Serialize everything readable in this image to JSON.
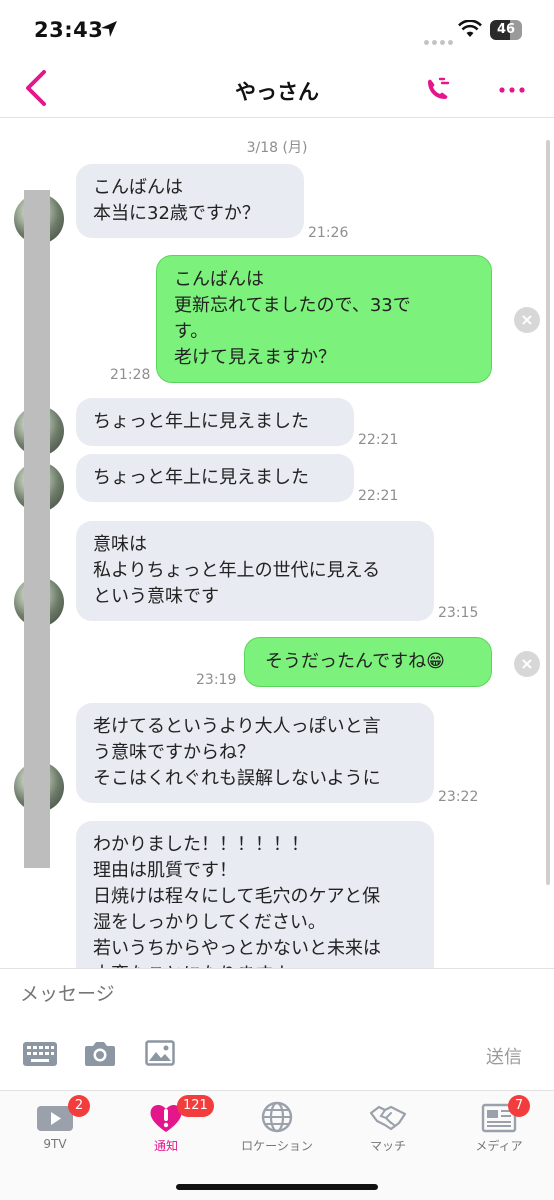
{
  "status": {
    "time": "23:43",
    "battery": "46"
  },
  "header": {
    "title": "やっさん"
  },
  "chat": {
    "date": "3/18 (月)",
    "messages": [
      {
        "side": "in",
        "text": "こんばんは\n本当に32歳ですか？",
        "time": "21:26"
      },
      {
        "side": "out",
        "text": "こんばんは\n更新忘れてましたので、33で\nす。\n老けて見えますか？",
        "time": "21:28"
      },
      {
        "side": "in",
        "text": "ちょっと年上に見えました",
        "time": "22:21"
      },
      {
        "side": "in",
        "text": "ちょっと年上に見えました",
        "time": "22:21"
      },
      {
        "side": "in",
        "text": "意味は\n私よりちょっと年上の世代に見える\nという意味です",
        "time": "23:15"
      },
      {
        "side": "out",
        "text": "そうだったんですね😁",
        "time": "23:19"
      },
      {
        "side": "in",
        "text": "老けてるというより大人っぽいと言\nう意味ですからね？\nそこはくれぐれも誤解しないように",
        "time": "23:22"
      },
      {
        "side": "in",
        "text": "わかりました！！！！！！\n理由は肌質です！\n日焼けは程々にして毛穴のケアと保\n湿をしっかりしてください。\n若いうちからやっとかないと未来は\n大変なことになりますよ",
        "time": ""
      }
    ],
    "close_symbol": "×"
  },
  "input": {
    "placeholder": "メッセージ",
    "send_label": "送信"
  },
  "tabs": [
    {
      "label": "9TV",
      "badge": "2",
      "icon": "tv-play-icon"
    },
    {
      "label": "通知",
      "badge": "121",
      "icon": "heart-alert-icon"
    },
    {
      "label": "ロケーション",
      "badge": "",
      "icon": "globe-icon"
    },
    {
      "label": "マッチ",
      "badge": "",
      "icon": "handshake-icon"
    },
    {
      "label": "メディア",
      "badge": "7",
      "icon": "news-icon"
    }
  ],
  "colors": {
    "accent": "#e4168c",
    "out_bubble": "#7cf27c",
    "in_bubble": "#e8ebf1",
    "badge": "#f33d3d"
  }
}
